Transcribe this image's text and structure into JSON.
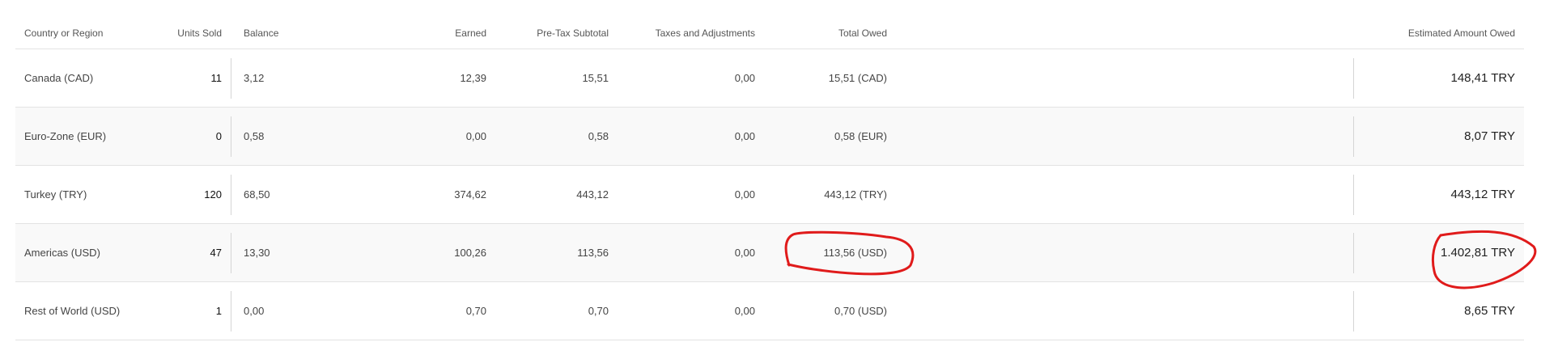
{
  "table": {
    "headers": {
      "region": "Country or Region",
      "units": "Units Sold",
      "balance": "Balance",
      "earned": "Earned",
      "pretax": "Pre-Tax Subtotal",
      "taxes": "Taxes and Adjustments",
      "total": "Total Owed",
      "estimated": "Estimated Amount Owed"
    },
    "rows": [
      {
        "region": "Canada (CAD)",
        "units": "11",
        "balance": "3,12",
        "earned": "12,39",
        "pretax": "15,51",
        "taxes": "0,00",
        "total": "15,51 (CAD)",
        "estimated": "148,41 TRY"
      },
      {
        "region": "Euro-Zone (EUR)",
        "units": "0",
        "balance": "0,58",
        "earned": "0,00",
        "pretax": "0,58",
        "taxes": "0,00",
        "total": "0,58 (EUR)",
        "estimated": "8,07 TRY"
      },
      {
        "region": "Turkey (TRY)",
        "units": "120",
        "balance": "68,50",
        "earned": "374,62",
        "pretax": "443,12",
        "taxes": "0,00",
        "total": "443,12 (TRY)",
        "estimated": "443,12 TRY"
      },
      {
        "region": "Americas (USD)",
        "units": "47",
        "balance": "13,30",
        "earned": "100,26",
        "pretax": "113,56",
        "taxes": "0,00",
        "total": "113,56 (USD)",
        "estimated": "1.402,81 TRY"
      },
      {
        "region": "Rest of World (USD)",
        "units": "1",
        "balance": "0,00",
        "earned": "0,70",
        "pretax": "0,70",
        "taxes": "0,00",
        "total": "0,70 (USD)",
        "estimated": "8,65 TRY"
      }
    ]
  },
  "colors": {
    "link": "#1a73c9",
    "annotation": "#e01b1b",
    "row_stripe": "#f9f9f9"
  }
}
